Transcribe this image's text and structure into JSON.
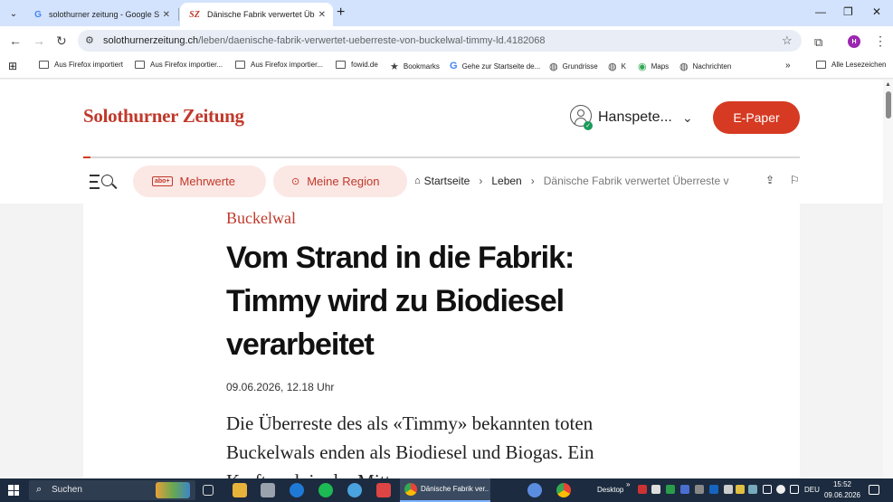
{
  "browser": {
    "tabs": [
      {
        "title": "solothurner zeitung - Google Suche"
      },
      {
        "title": "Dänische Fabrik verwertet Überreste",
        "favicon_text": "SZ"
      }
    ],
    "url": {
      "host": "solothurnerzeitung.ch",
      "path": "/leben/daenische-fabrik-verwertet-ueberreste-von-buckelwal-timmy-ld.4182068"
    },
    "profile_initial": "H",
    "bookmarks": [
      "Aus Firefox importiert",
      "Aus Firefox importier...",
      "Aus Firefox importier...",
      "fowid.de",
      "Bookmarks",
      "Gehe zur Startseite de...",
      "Grundrisse",
      "K",
      "Maps",
      "Nachrichten"
    ],
    "all_bookmarks": "Alle Lesezeichen"
  },
  "site": {
    "logo": "Solothurner Zeitung",
    "user_name": "Hanspete...",
    "epaper_label": "E-Paper",
    "pills": [
      {
        "icon": "abo+",
        "label": "Mehrwerte"
      },
      {
        "label": "Meine Region"
      }
    ],
    "breadcrumb": {
      "home": "Startseite",
      "section": "Leben",
      "current": "Dänische Fabrik verwertet Überreste von Buckelwal Timmy"
    }
  },
  "article": {
    "kicker": "Buckelwal",
    "headline": "Vom Strand in die Fabrik: Timmy wird zu Biodiesel verarbeitet",
    "date": "09.06.2026, 12.18 Uhr",
    "lead": "Die Überreste des als «Timmy» bekannten toten Buckelwals enden als Biodiesel und Biogas. Ein Kraftwerk in der Mitte"
  },
  "taskbar": {
    "search_label": "Suchen",
    "active_window": "Dänische Fabrik ver...",
    "desktop_label": "Desktop",
    "language": "DEU",
    "time": "15:52",
    "date": "09.06.2026"
  }
}
